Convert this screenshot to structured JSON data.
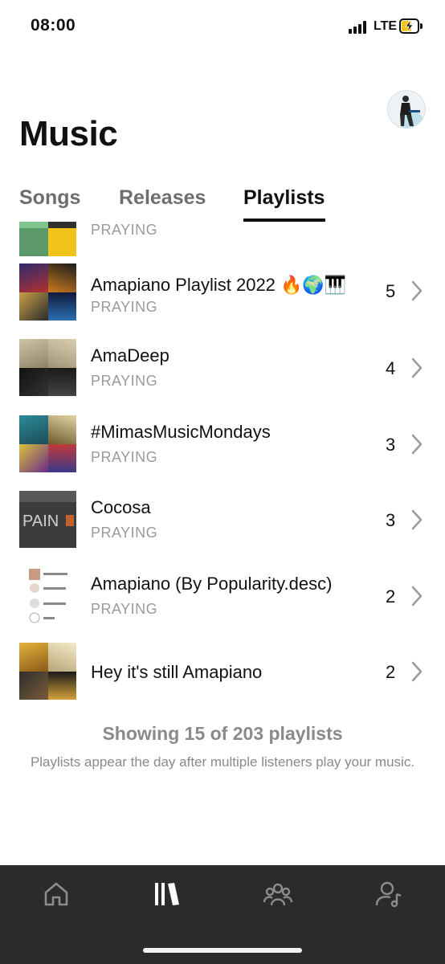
{
  "status_bar": {
    "time": "08:00",
    "network": "LTE",
    "icons": [
      "signal-icon",
      "battery-charging-icon"
    ]
  },
  "header": {
    "title": "Music",
    "avatar": "profile-avatar"
  },
  "tabs": [
    {
      "label": "Songs",
      "active": false
    },
    {
      "label": "Releases",
      "active": false
    },
    {
      "label": "Playlists",
      "active": true
    }
  ],
  "playlists": [
    {
      "title": "",
      "subtitle": "PRAYING",
      "count": "",
      "partial": true
    },
    {
      "title": "Amapiano Playlist 2022 🔥🌍🎹",
      "subtitle": "PRAYING",
      "count": "5"
    },
    {
      "title": "AmaDeep",
      "subtitle": "PRAYING",
      "count": "4"
    },
    {
      "title": "#MimasMusicMondays",
      "subtitle": "PRAYING",
      "count": "3"
    },
    {
      "title": "Cocosa",
      "subtitle": "PRAYING",
      "count": "3"
    },
    {
      "title": "Amapiano (By Popularity.desc)",
      "subtitle": "PRAYING",
      "count": "2"
    },
    {
      "title": "Hey it's still Amapiano",
      "subtitle": "",
      "count": "2"
    }
  ],
  "footer": {
    "showing": "Showing 15 of 203 playlists",
    "note": "Playlists appear the day after multiple listeners play your music."
  },
  "bottom_nav": [
    {
      "icon": "home-icon",
      "active": false
    },
    {
      "icon": "library-icon",
      "active": true
    },
    {
      "icon": "audience-icon",
      "active": false
    },
    {
      "icon": "artist-profile-icon",
      "active": false
    }
  ],
  "colors": {
    "accent": "#111111",
    "muted": "#8a8a8a",
    "nav_bg": "#2b2b2b",
    "battery_fill": "#f2c318"
  }
}
